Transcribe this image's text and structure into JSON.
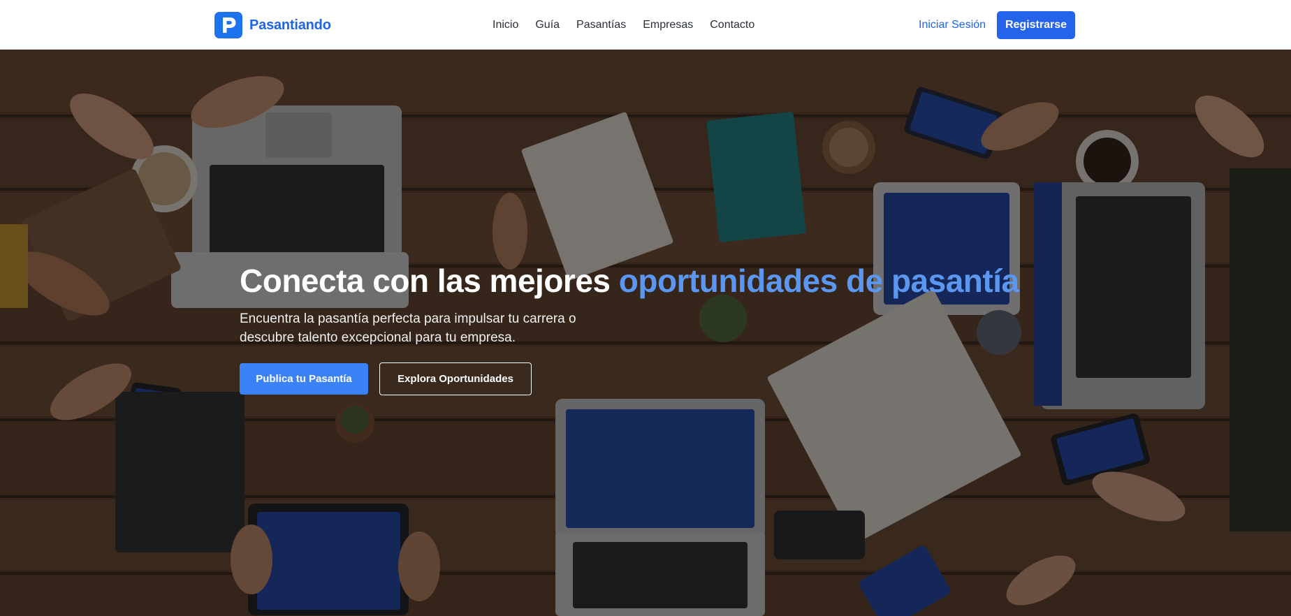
{
  "brand": {
    "logo_letter": "P",
    "name": "Pasantiando",
    "color": "#1d72f0",
    "icon": "logo-p-icon"
  },
  "nav": {
    "links": [
      {
        "label": "Inicio"
      },
      {
        "label": "Guía"
      },
      {
        "label": "Pasantías"
      },
      {
        "label": "Empresas"
      },
      {
        "label": "Contacto"
      }
    ],
    "login_label": "Iniciar Sesión",
    "register_label": "Registrarse"
  },
  "hero": {
    "title_part1": "Conecta con las mejores ",
    "title_accent": "oportunidades de pasantía",
    "subtitle": "Encuentra la pasantía perfecta para impulsar tu carrera o descubre talento excepcional para tu empresa.",
    "primary_button": "Publica tu Pasantía",
    "secondary_button": "Explora Oportunidades",
    "background_image": "team-desk-overhead-photo",
    "accent_color": "#5b96f0"
  }
}
